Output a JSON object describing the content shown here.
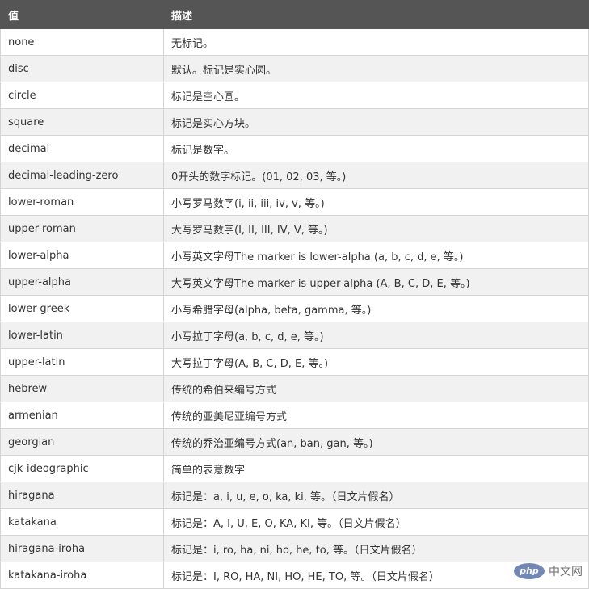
{
  "table": {
    "headers": [
      "值",
      "描述"
    ],
    "rows": [
      [
        "none",
        "无标记。"
      ],
      [
        "disc",
        "默认。标记是实心圆。"
      ],
      [
        "circle",
        "标记是空心圆。"
      ],
      [
        "square",
        "标记是实心方块。"
      ],
      [
        "decimal",
        "标记是数字。"
      ],
      [
        "decimal-leading-zero",
        "0开头的数字标记。(01, 02, 03, 等。)"
      ],
      [
        "lower-roman",
        "小写罗马数字(i, ii, iii, iv, v, 等。)"
      ],
      [
        "upper-roman",
        "大写罗马数字(I, II, III, IV, V, 等。)"
      ],
      [
        "lower-alpha",
        "小写英文字母The marker is lower-alpha (a, b, c, d, e, 等。)"
      ],
      [
        "upper-alpha",
        "大写英文字母The marker is upper-alpha (A, B, C, D, E, 等。)"
      ],
      [
        "lower-greek",
        "小写希腊字母(alpha, beta, gamma, 等。)"
      ],
      [
        "lower-latin",
        "小写拉丁字母(a, b, c, d, e, 等。)"
      ],
      [
        "upper-latin",
        "大写拉丁字母(A, B, C, D, E, 等。)"
      ],
      [
        "hebrew",
        "传统的希伯来编号方式"
      ],
      [
        "armenian",
        "传统的亚美尼亚编号方式"
      ],
      [
        "georgian",
        "传统的乔治亚编号方式(an, ban, gan, 等。)"
      ],
      [
        "cjk-ideographic",
        "简单的表意数字"
      ],
      [
        "hiragana",
        "标记是：a, i, u, e, o, ka, ki, 等。（日文片假名）"
      ],
      [
        "katakana",
        "标记是：A, I, U, E, O, KA, KI, 等。（日文片假名）"
      ],
      [
        "hiragana-iroha",
        "标记是：i, ro, ha, ni, ho, he, to, 等。（日文片假名）"
      ],
      [
        "katakana-iroha",
        "标记是：I, RO, HA, NI, HO, HE, TO, 等。（日文片假名）"
      ]
    ]
  },
  "watermark": {
    "logo_text": "php",
    "site_text": "中文网"
  }
}
